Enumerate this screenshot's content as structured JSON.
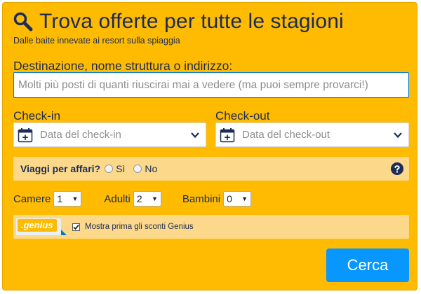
{
  "header": {
    "title": "Trova offerte per tutte le stagioni",
    "subtitle": "Dalle baite innevate ai resort sulla spiaggia"
  },
  "destination": {
    "label": "Destinazione, nome struttura o indirizzo:",
    "placeholder": "Molti più posti di quanti riuscirai mai a vedere (ma puoi sempre provarci!)",
    "value": ""
  },
  "checkin": {
    "label": "Check-in",
    "placeholder": "Data del check-in"
  },
  "checkout": {
    "label": "Check-out",
    "placeholder": "Data del check-out"
  },
  "business": {
    "question": "Viaggi per affari?",
    "options": [
      "Sì",
      "No"
    ],
    "selected": null
  },
  "occupancy": {
    "rooms_label": "Camere",
    "rooms_value": "1",
    "adults_label": "Adulti",
    "adults_value": "2",
    "children_label": "Bambini",
    "children_value": "0"
  },
  "genius": {
    "logo_text": ".genius",
    "checkbox_label": "Mostra prima gli sconti Genius",
    "checked": true
  },
  "actions": {
    "search_label": "Cerca"
  },
  "colors": {
    "panel_bg": "#febb02",
    "row_bg": "#fcd98a",
    "title_text": "#1c2b57",
    "search_button": "#0896ff",
    "input_focus_border": "#0077cc"
  },
  "icons": {
    "title": "magnifier-icon",
    "calendar": "calendar-icon",
    "dropdown": "chevron-down-icon",
    "help": "help-icon"
  }
}
